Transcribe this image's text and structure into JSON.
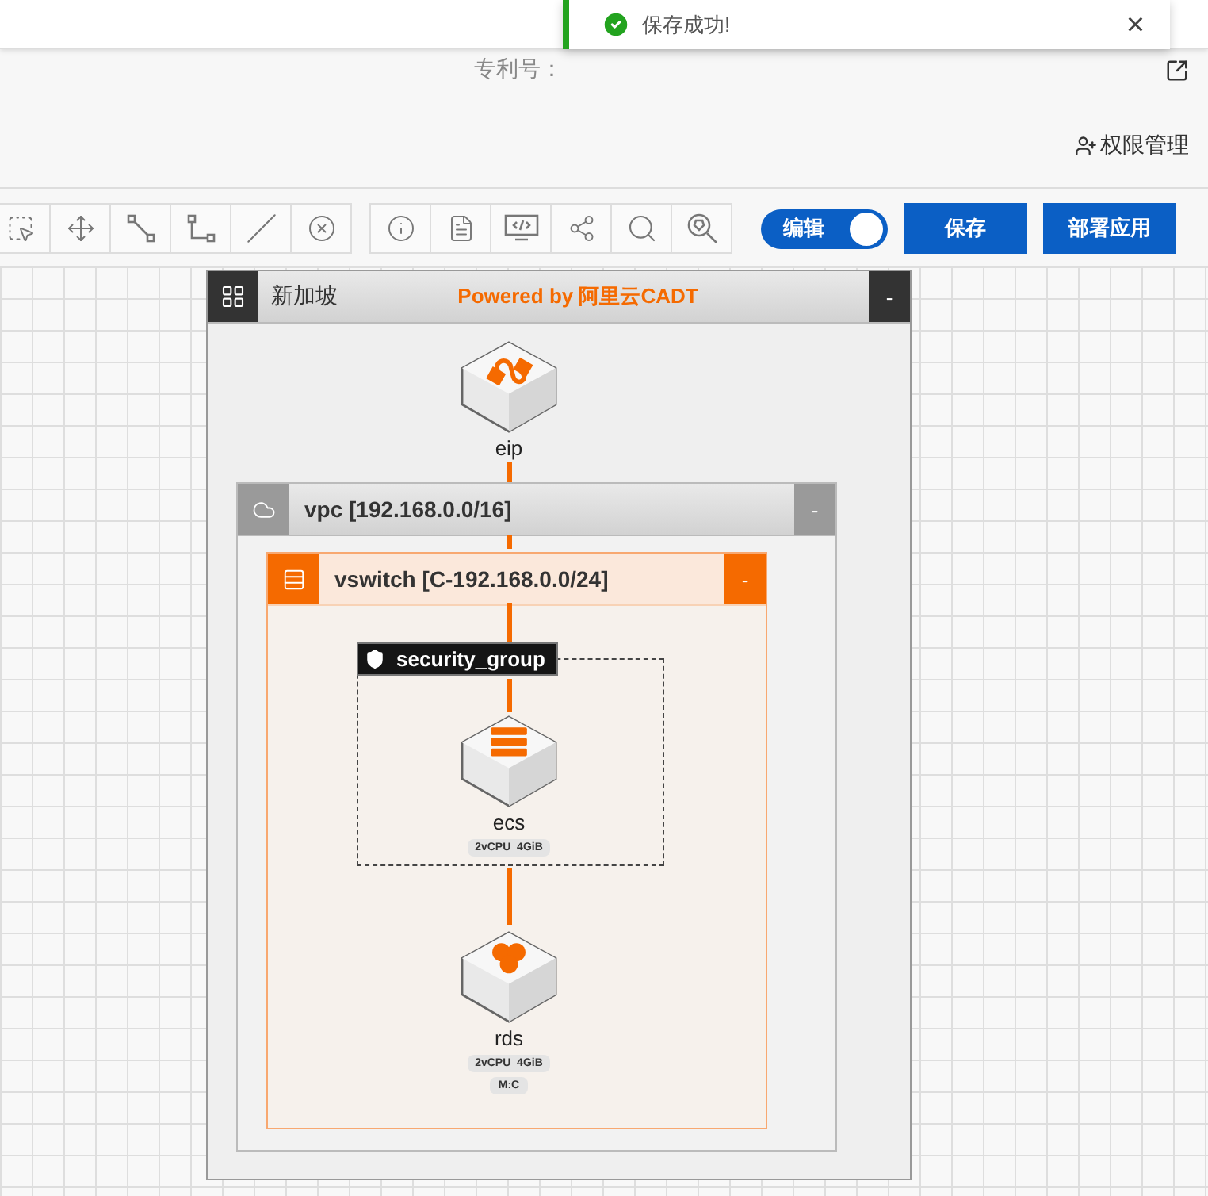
{
  "toast": {
    "kind": "success",
    "message": "保存成功!",
    "close": "×"
  },
  "header": {
    "patent_label": "专利号：",
    "permission_link": "权限管理"
  },
  "toolbar": {
    "edit_toggle": {
      "label": "编辑",
      "on": true
    },
    "buttons": [
      "保存",
      "部署应用"
    ]
  },
  "region": {
    "title": "新加坡",
    "powered_by": "Powered by 阿里云CADT",
    "collapse": "-",
    "nodes": [
      {
        "name": "eip",
        "kind": "eip"
      }
    ],
    "vpc": {
      "title": "vpc [192.168.0.0/16]",
      "collapse": "-",
      "vswitch": {
        "title": "vswitch [C-192.168.0.0/24]",
        "collapse": "-",
        "security_group": {
          "title": "security_group",
          "nodes": [
            {
              "name": "ecs",
              "kind": "ecs",
              "badges": [
                "2vCPU  4GiB"
              ]
            }
          ]
        },
        "nodes": [
          {
            "name": "rds",
            "kind": "rds",
            "badges": [
              "2vCPU  4GiB",
              "M:C"
            ]
          }
        ]
      }
    }
  }
}
